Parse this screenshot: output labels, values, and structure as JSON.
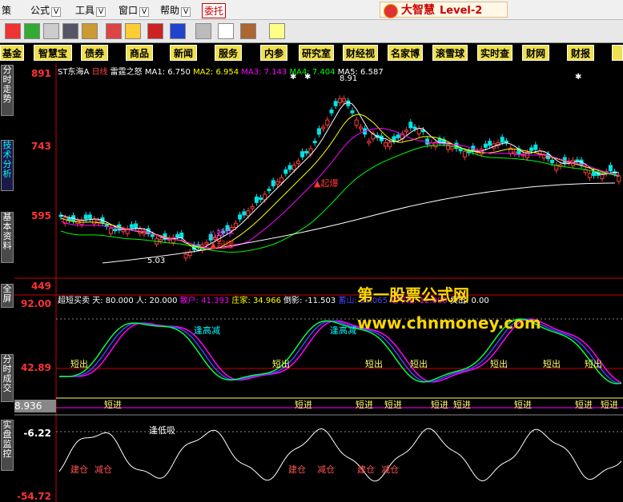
{
  "menu": {
    "items": [
      "策",
      "公式",
      "工具",
      "窗口",
      "帮助"
    ],
    "entrust": "委托"
  },
  "brand": {
    "name": "大智慧",
    "level": "Level-2"
  },
  "quickbar": [
    "基金",
    "智慧宝",
    "债券",
    "商品",
    "新闻",
    "服务",
    "内参",
    "研究室",
    "财经视",
    "名家博",
    "滚雪球",
    "实时查",
    "财网",
    "财报"
  ],
  "sidetabs": [
    "分时走势",
    "技术分析",
    "基本资料",
    "全屏",
    "分时成交",
    "实盘监控"
  ],
  "main": {
    "stock": "ST东海A",
    "period": "日线",
    "indicator": "雷霆之怒",
    "ma": [
      "MA1: 6.750",
      "MA2: 6.954",
      "MA3: 7.143",
      "MA4: 7.404",
      "MA5: 6.587"
    ],
    "price_high_label": "8.91",
    "price_low_label": "5.03",
    "signals": {
      "qibao": "起爆",
      "yaoniu": "妖牛"
    },
    "y_labels": [
      "891",
      "743",
      "595",
      "449"
    ]
  },
  "osc1": {
    "title": "超短买卖",
    "values": [
      "天: 80.000",
      "人: 20.000",
      "散户: 41.393",
      "庄家: 34.966",
      "倒影: -11.503",
      "蓄山: 36.065",
      "地平线: 12.000",
      "卖出: 0.00"
    ],
    "y_labels": [
      "92.00",
      "42.89",
      "8.936"
    ],
    "sell_label": "短出",
    "buy_label": "短进",
    "top_label": "逢高减"
  },
  "osc2": {
    "y_labels": [
      "-6.22",
      "-54.72"
    ],
    "dip_label": "逢低吸",
    "build_label": "建仓",
    "reduce_label": "减仓"
  },
  "watermark": {
    "line1": "第一股票公式网",
    "line2": "www.chnmoney.com"
  },
  "chart_data": {
    "type": "line",
    "ma_values": {
      "MA1": 6.75,
      "MA2": 6.954,
      "MA3": 7.143,
      "MA4": 7.404,
      "MA5": 6.587
    },
    "ylim": [
      4.49,
      8.91
    ]
  },
  "colors": {
    "up": "#ff3b3b",
    "down": "#00e5e5",
    "ma1": "#ffffff",
    "ma2": "#ffff00",
    "ma3": "#ff00ff",
    "ma4": "#00ff00",
    "ma5": "#ffffff"
  }
}
